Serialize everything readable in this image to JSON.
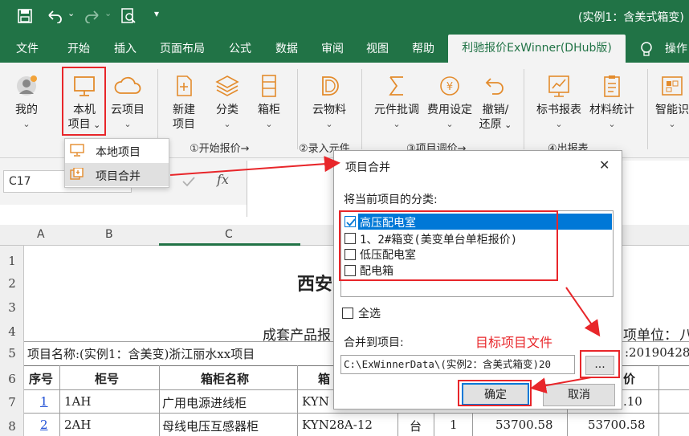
{
  "title_bar": {
    "window_title": "(实例1：含美式箱变)"
  },
  "tabs": [
    "文件",
    "开始",
    "插入",
    "页面布局",
    "公式",
    "数据",
    "审阅",
    "视图",
    "帮助"
  ],
  "active_tab": "利驰报价ExWinner(DHub版)",
  "tell_me_label": "操作",
  "ribbon": {
    "buttons": {
      "mine": "我的",
      "local_project_1": "本机",
      "local_project_2": "项目",
      "cloud_project": "云项目",
      "new_project_1": "新建",
      "new_project_2": "项目",
      "category": "分类",
      "cabinet": "箱柜",
      "cloud_material": "云物料",
      "component_adjust": "元件批调",
      "fee_setting": "费用设定",
      "undo_1": "撤销/",
      "undo_2": "还原",
      "bid_report": "标书报表",
      "material_stats": "材料统计",
      "smart": "智能识"
    },
    "groups": {
      "start_quote": "①开始报价→",
      "enter_component": "②录入元件",
      "adjust_project": "③项目调价→",
      "output_report": "④出报表"
    }
  },
  "dropdown": {
    "items": [
      "本地项目",
      "项目合并"
    ]
  },
  "namebox": "C17",
  "fx_label": "fx",
  "columns": [
    "A",
    "B",
    "C"
  ],
  "rows": [
    "1",
    "2",
    "3",
    "4",
    "5",
    "6",
    "7",
    "8"
  ],
  "sheet": {
    "title_fragment": "西安",
    "subtitle_fragment": "成套产品报",
    "unit_fragment": "项单位：",
    "unit_fragment_end": "八",
    "project_name": "项目名称:(实例1：含美变)浙江丽水xx项目",
    "date_fragment": ":20190428",
    "headers": {
      "seq": "序号",
      "cabinet_no": "柜号",
      "cabinet_name": "箱柜名称",
      "model_fragment": "箱",
      "price_fragment": "价"
    },
    "rows": [
      {
        "seq": "1",
        "cabinet_no": "1AH",
        "name": "广用电源进线柜",
        "model": "KYN",
        "price_end": ".10"
      },
      {
        "seq": "2",
        "cabinet_no": "2AH",
        "name": "母线电压互感器柜",
        "model": "KYN28A-12",
        "unit": "台",
        "qty": "1",
        "price": "53700.58",
        "total": "53700.58"
      }
    ]
  },
  "dialog": {
    "title": "项目合并",
    "close": "✕",
    "category_label": "将当前项目的分类:",
    "categories": [
      {
        "label": "高压配电室",
        "checked": true
      },
      {
        "label": "1、2#箱变(美变单台单柜报价)",
        "checked": false
      },
      {
        "label": "低压配电室",
        "checked": false
      },
      {
        "label": "配电箱",
        "checked": false
      }
    ],
    "select_all": "全选",
    "merge_to_label": "合并到项目:",
    "path_value": "C:\\ExWinnerData\\(实例2：含美式箱变)20",
    "browse_label": "...",
    "ok_label": "确定",
    "cancel_label": "取消"
  },
  "annotation": {
    "target_label": "目标项目文件",
    "accent": "#e8262a"
  },
  "colors": {
    "excel_green": "#217346",
    "selection_blue": "#0078d7"
  }
}
